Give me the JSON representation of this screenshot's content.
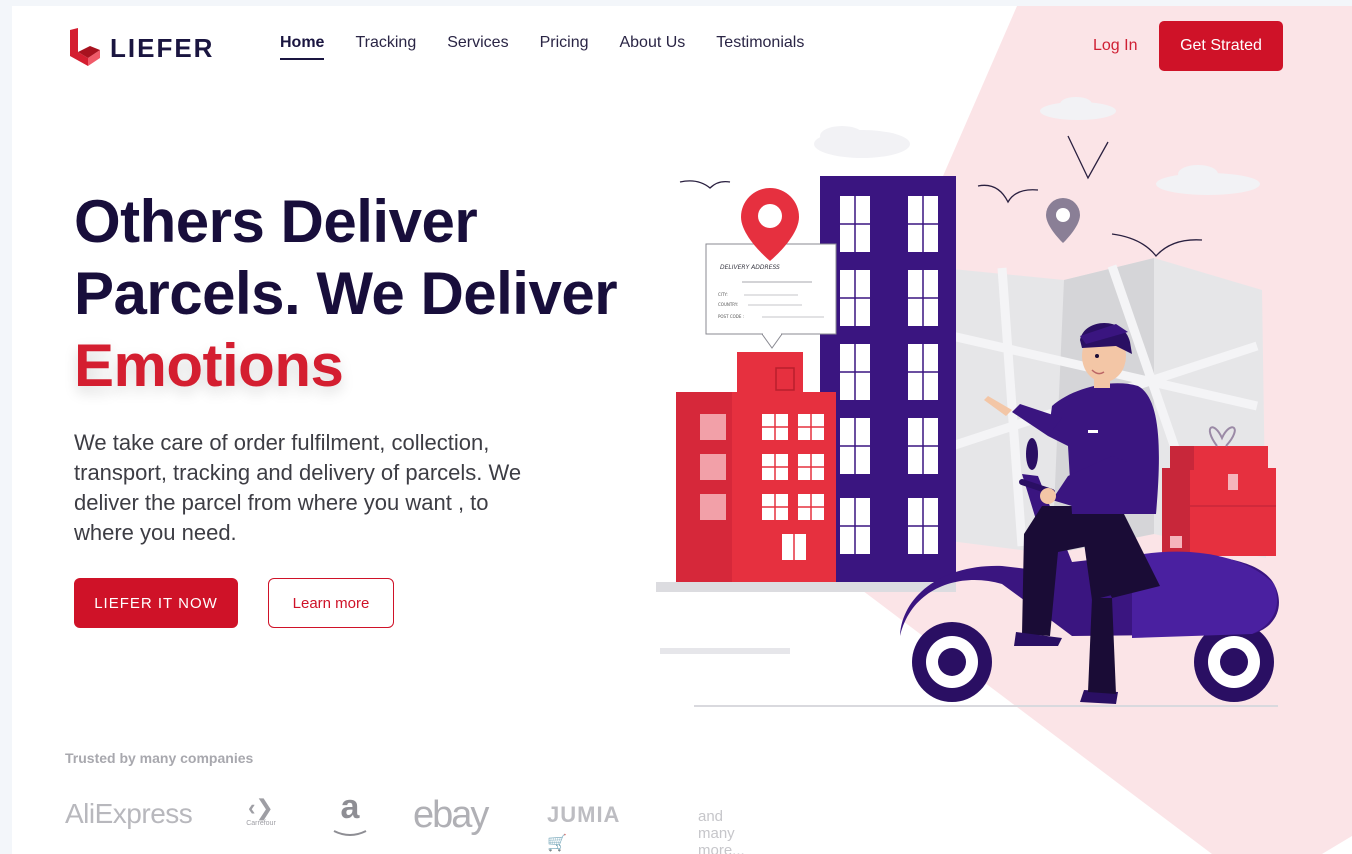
{
  "brand": {
    "name": "LIEFER"
  },
  "nav": {
    "items": [
      {
        "label": "Home",
        "active": true
      },
      {
        "label": "Tracking"
      },
      {
        "label": "Services"
      },
      {
        "label": "Pricing"
      },
      {
        "label": "About Us"
      },
      {
        "label": "Testimonials"
      }
    ],
    "login_label": "Log In",
    "cta_label": "Get Strated"
  },
  "hero": {
    "headline_line1": "Others Deliver",
    "headline_line2": "Parcels. We Deliver",
    "headline_accent": "Emotions",
    "subtitle": "We take care of order fulfilment, collection, transport, tracking and delivery of parcels. We deliver the parcel from where you want , to where you need.",
    "primary_button": "LIEFER IT NOW",
    "secondary_button": "Learn more"
  },
  "illustration": {
    "address_card": {
      "title": "DELIVERY ADDRESS",
      "fields": [
        "CITY:",
        "COUNTRY:",
        "POST CODE :"
      ]
    }
  },
  "trusted": {
    "label": "Trusted by many companies",
    "brands": [
      "AliExpress",
      "Carrefour",
      "a",
      "ebay",
      "JUMIA"
    ],
    "more": "and many more..."
  },
  "colors": {
    "accent": "#cf1228",
    "dark": "#180e3b",
    "purple": "#3a1580",
    "pink_bg": "#fbe4e7"
  }
}
